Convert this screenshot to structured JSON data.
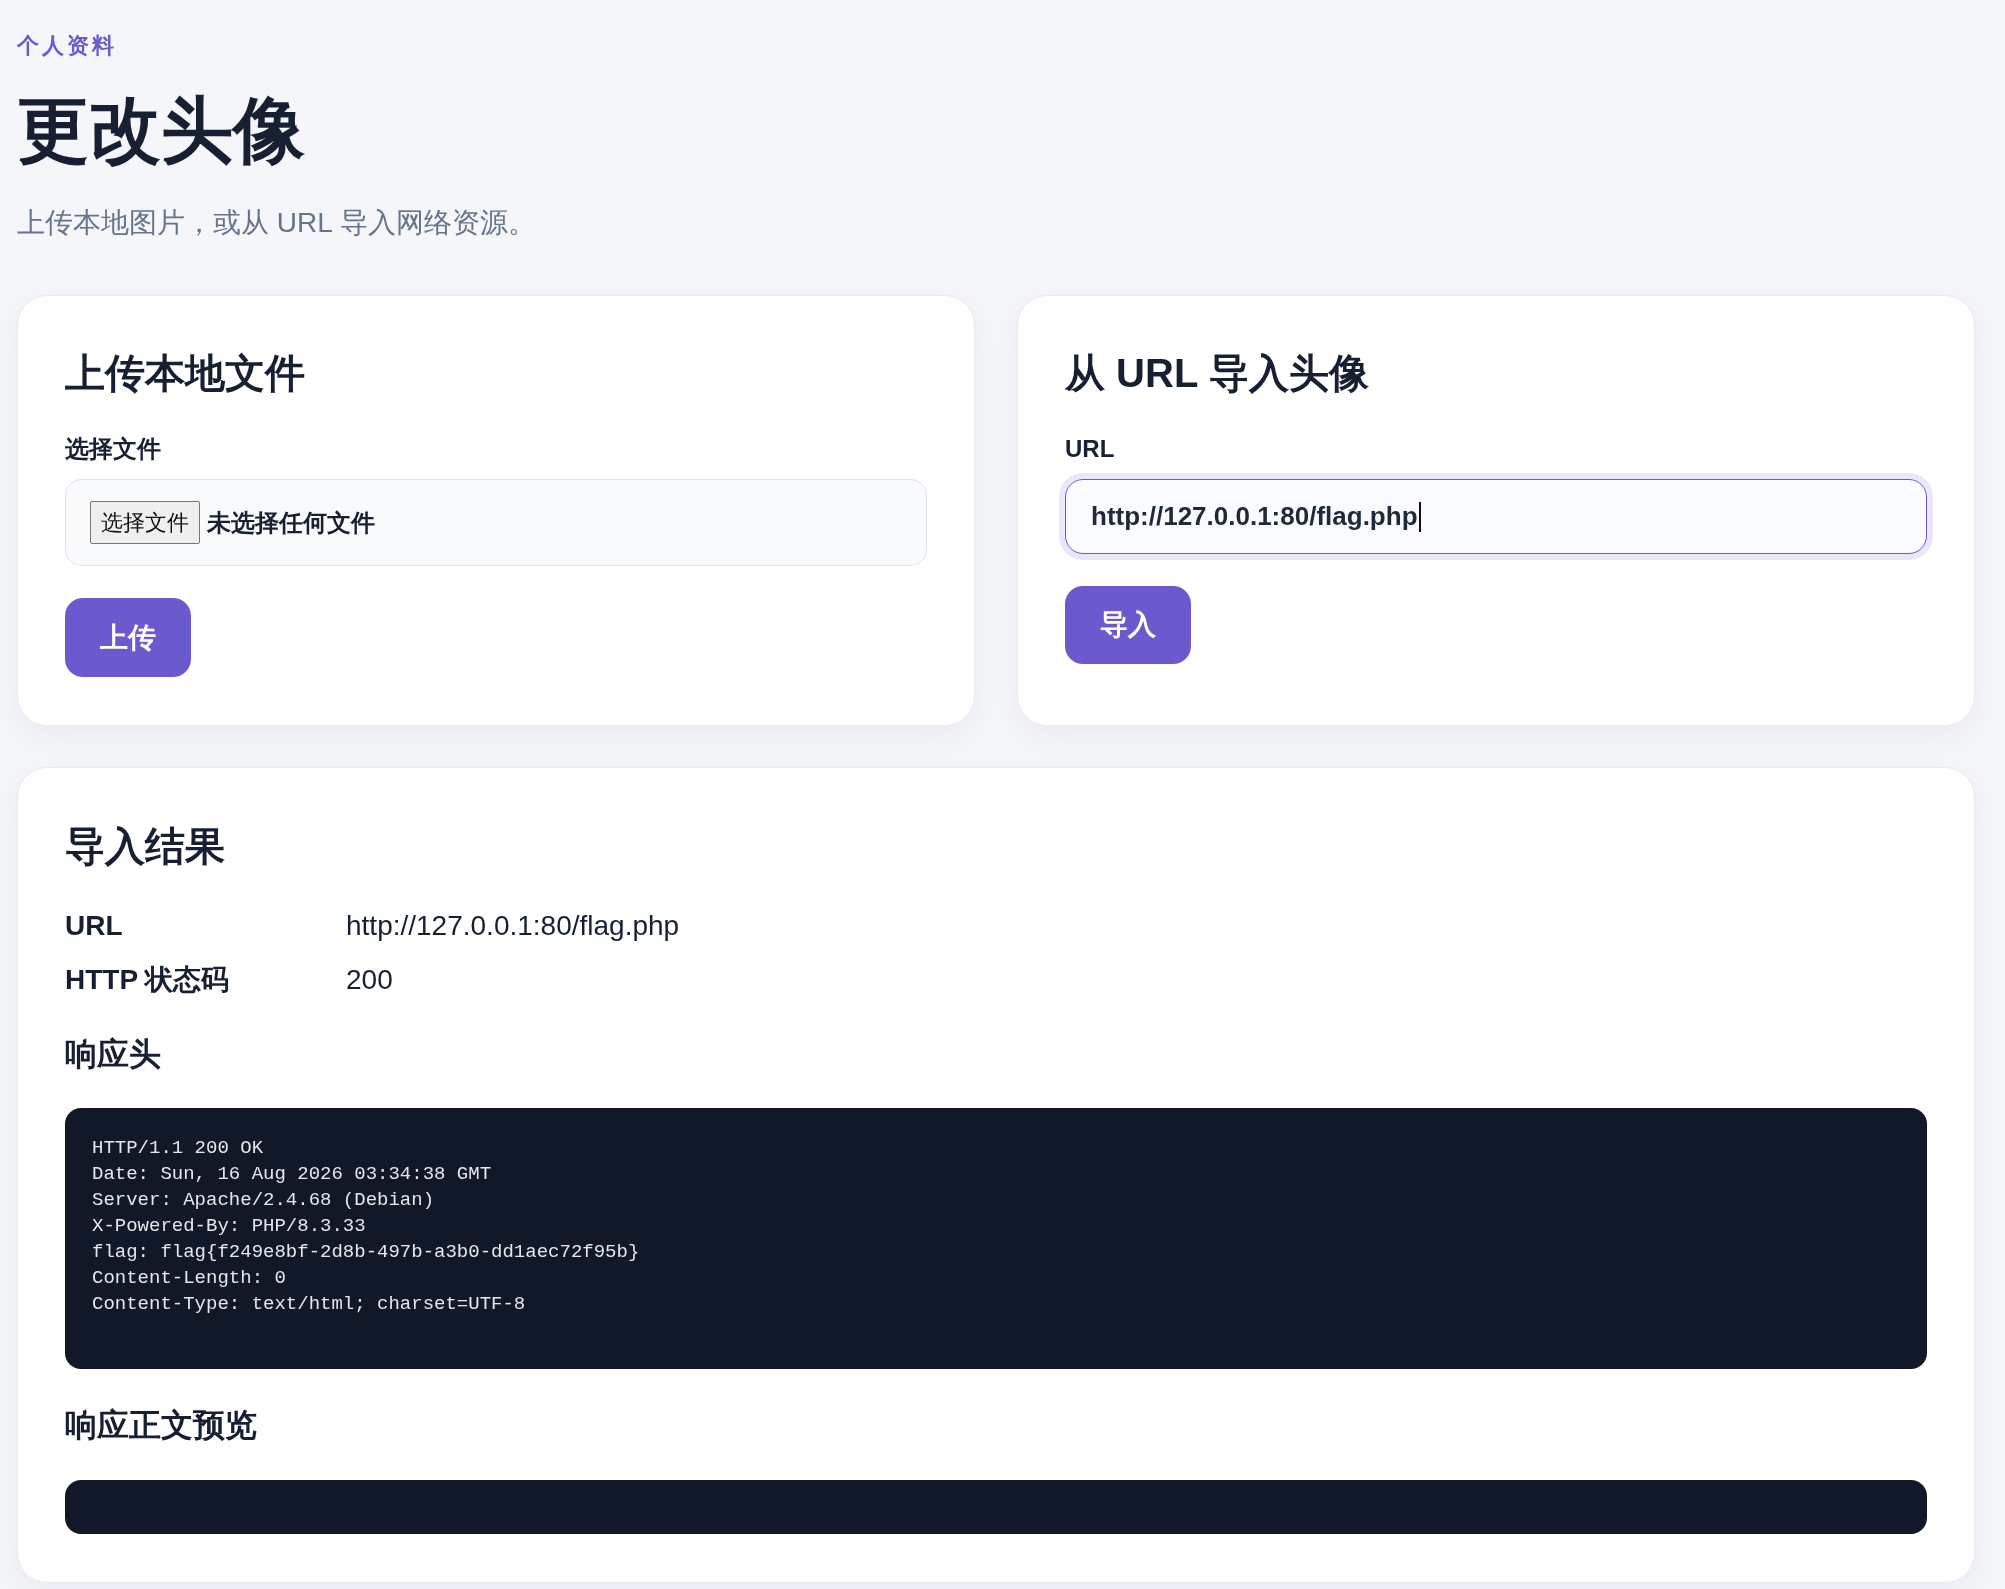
{
  "header": {
    "eyebrow": "个人资料",
    "title": "更改头像",
    "subtitle": "上传本地图片，或从 URL 导入网络资源。"
  },
  "upload_card": {
    "title": "上传本地文件",
    "field_label": "选择文件",
    "file_button": "选择文件",
    "file_status": "未选择任何文件",
    "submit_button": "上传"
  },
  "url_card": {
    "title": "从 URL 导入头像",
    "field_label": "URL",
    "value": "http://127.0.0.1:80/flag.php",
    "focused": true,
    "submit_button": "导入"
  },
  "result": {
    "title": "导入结果",
    "fields": [
      {
        "label": "URL",
        "value": "http://127.0.0.1:80/flag.php"
      },
      {
        "label": "HTTP 状态码",
        "value": "200"
      }
    ],
    "headers_title": "响应头",
    "header_lines": [
      "HTTP/1.1 200 OK",
      "Date: Sun, 16 Aug 2026 03:34:38 GMT",
      "Server: Apache/2.4.68 (Debian)",
      "X-Powered-By: PHP/8.3.33",
      "flag: flag{f249e8bf-2d8b-497b-a3b0-dd1aec72f95b}",
      "Content-Length: 0",
      "Content-Type: text/html; charset=UTF-8"
    ],
    "body_title": "响应正文预览"
  }
}
